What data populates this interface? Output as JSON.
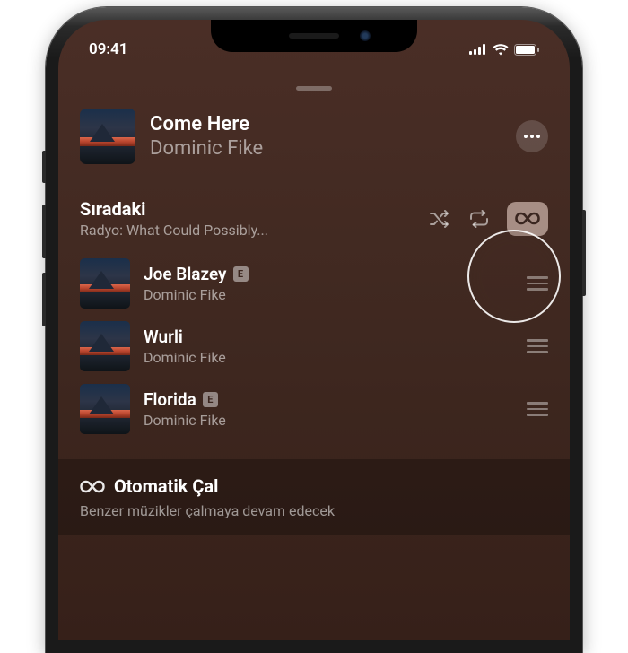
{
  "statusBar": {
    "time": "09:41"
  },
  "nowPlaying": {
    "title": "Come Here",
    "artist": "Dominic Fike"
  },
  "queue": {
    "title": "Sıradaki",
    "subtitle": "Radyo: What Could Possibly...",
    "items": [
      {
        "title": "Joe Blazey",
        "artist": "Dominic Fike",
        "explicit": true
      },
      {
        "title": "Wurli",
        "artist": "Dominic Fike",
        "explicit": false
      },
      {
        "title": "Florida",
        "artist": "Dominic Fike",
        "explicit": true
      }
    ]
  },
  "autoplay": {
    "title": "Otomatik Çal",
    "description": "Benzer müzikler çalmaya devam edecek"
  },
  "labels": {
    "explicit": "E"
  }
}
